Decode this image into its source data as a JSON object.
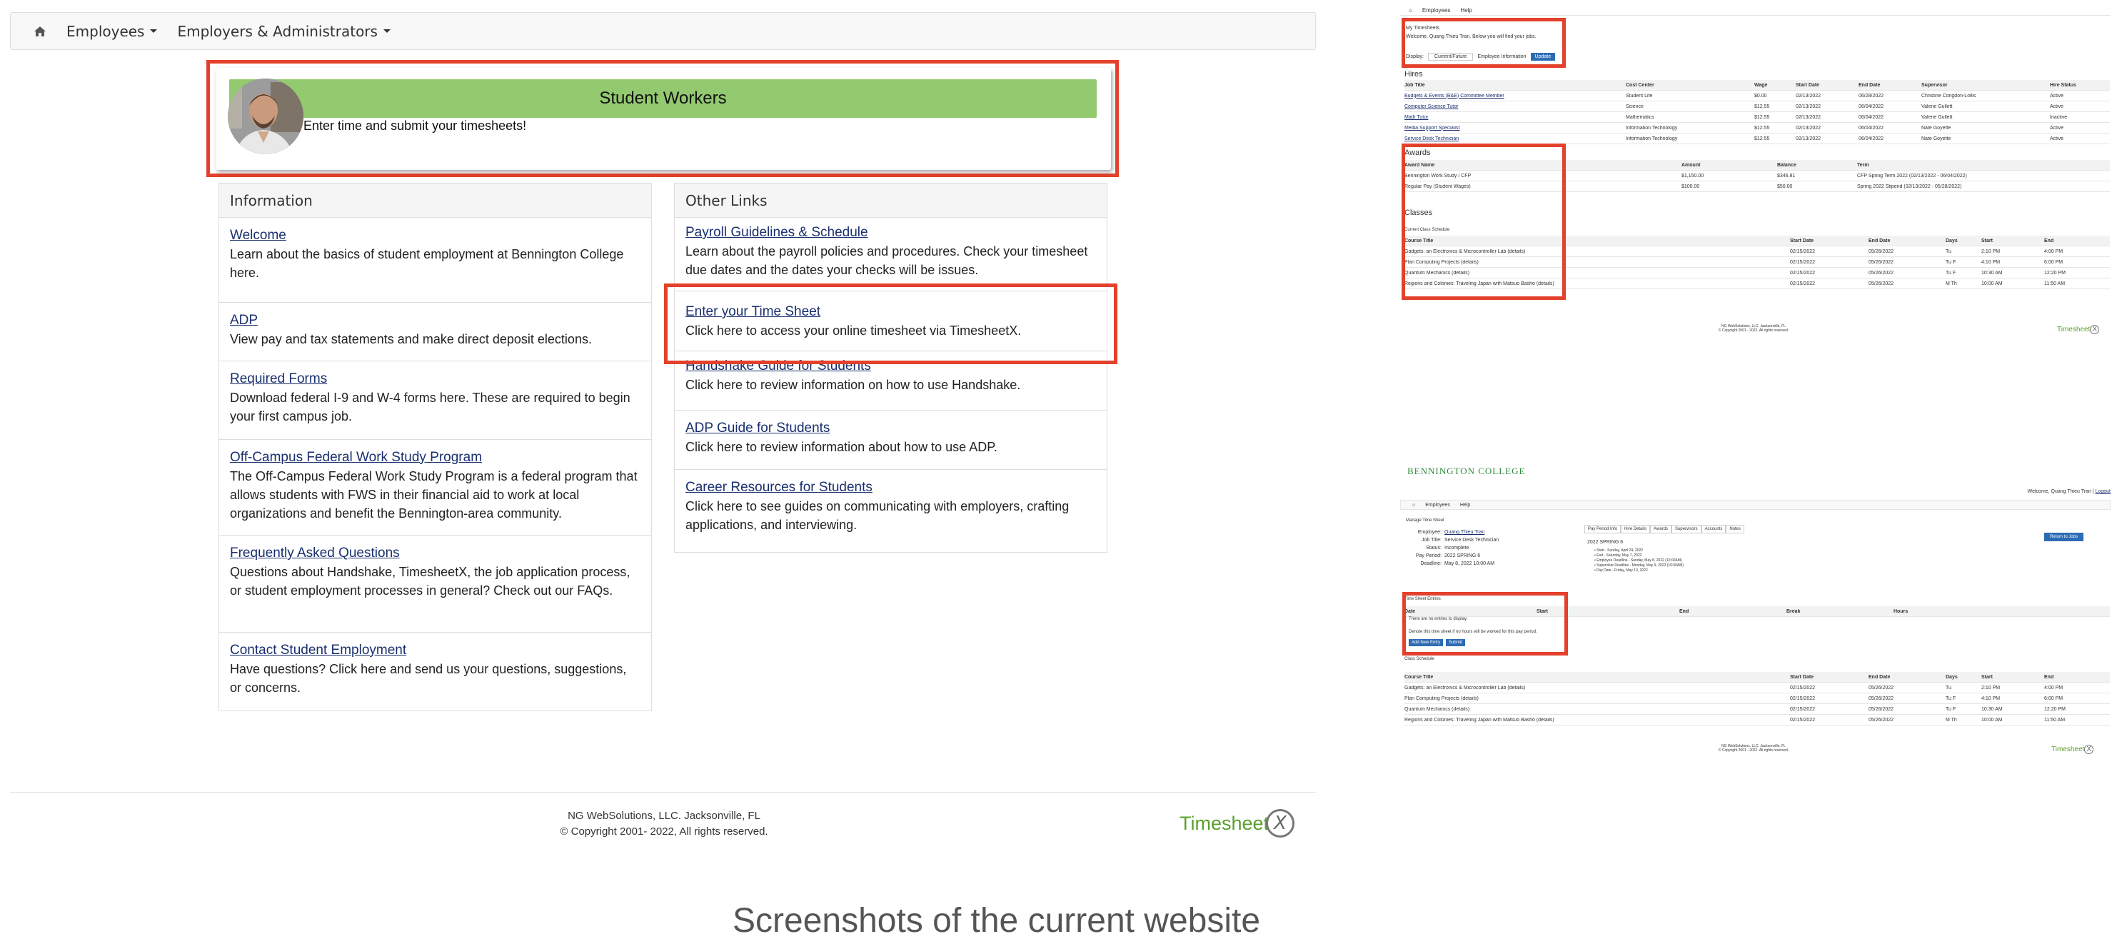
{
  "nav": {
    "employees": "Employees",
    "employers": "Employers & Administrators"
  },
  "banner": {
    "title": "Student Workers",
    "subtitle": "Enter time and submit your timesheets!",
    "color": "#93c96f"
  },
  "information": {
    "heading": "Information",
    "items": [
      {
        "title": "Welcome",
        "desc": "Learn about the basics of student employment at Bennington College here."
      },
      {
        "title": "ADP",
        "desc": "View pay and tax statements and make direct deposit elections."
      },
      {
        "title": "Required Forms",
        "desc": "Download federal I-9 and W-4 forms here. These are required to begin your first campus job."
      },
      {
        "title": "Off-Campus Federal Work Study Program",
        "desc": "The Off-Campus Federal Work Study Program is a federal program that allows students with FWS in their financial aid to work at local organizations and benefit the Bennington-area community."
      },
      {
        "title": "Frequently Asked Questions",
        "desc": "Questions about Handshake, TimesheetX, the job application process, or student employment processes in general? Check out our FAQs."
      },
      {
        "title": "Contact Student Employment",
        "desc": "Have questions? Click here and send us your questions, suggestions, or concerns."
      }
    ]
  },
  "other": {
    "heading": "Other Links",
    "items": [
      {
        "title": "Payroll Guidelines & Schedule",
        "desc": "Learn about the payroll policies and procedures. Check your timesheet due dates and the dates your checks will be issues."
      },
      {
        "title": "Enter your Time Sheet",
        "desc": "Click here to access your online timesheet via TimesheetX."
      },
      {
        "title": "Handshake Guide for Students",
        "desc": "Click here to review information on how to use Handshake."
      },
      {
        "title": "ADP Guide for Students",
        "desc": "Click here to review information about how to use ADP."
      },
      {
        "title": "Career Resources for Students",
        "desc": "Click here to see guides on communicating with employers, crafting applications, and interviewing."
      }
    ]
  },
  "footer": {
    "line1": "NG WebSolutions, LLC. Jacksonville, FL",
    "line2": "© Copyright 2001- 2022,  All rights reserved.",
    "logo": "Timesheet",
    "logo_x": "X"
  },
  "caption": "Screenshots of the current website",
  "right1": {
    "nav_employees": "Employees",
    "nav_help": "Help",
    "my_title": "My Timesheets",
    "welcome": "Welcome, Quang Thieu Tran. Below you will find your jobs.",
    "display_label": "Display:",
    "display_value": "Current/Future",
    "emp_info": "Employee Information",
    "update": "Update",
    "hires_heading": "Hires",
    "hires_cols": [
      "Job Title",
      "Cost Center",
      "Wage",
      "Start Date",
      "End Date",
      "Supervisor",
      "Hire Status"
    ],
    "hires_rows": [
      [
        "Budgets & Events (B&E) Committee Member",
        "Student Life",
        "$0.00",
        "02/13/2022",
        "06/28/2022",
        "Christine Congdon-Lollis",
        "Active"
      ],
      [
        "Computer Science Tutor",
        "Science",
        "$12.55",
        "02/13/2022",
        "06/04/2022",
        "Valerie Gullett",
        "Active"
      ],
      [
        "Math Tutor",
        "Mathematics",
        "$12.55",
        "02/13/2022",
        "06/04/2022",
        "Valerie Gullett",
        "Inactive"
      ],
      [
        "Media Support Specialist",
        "Information Technology",
        "$12.55",
        "02/13/2022",
        "06/04/2022",
        "Nate Goyette",
        "Active"
      ],
      [
        "Service Desk Technician",
        "Information Technology",
        "$12.55",
        "02/13/2022",
        "06/04/2022",
        "Nate Goyette",
        "Active"
      ]
    ],
    "awards_heading": "Awards",
    "awards_cols": [
      "Award Name",
      "Amount",
      "Balance",
      "Term"
    ],
    "awards_rows": [
      [
        "Bennington Work Study / CFP",
        "$1,150.00",
        "$346.81",
        "CFP Spring Term 2022 (02/13/2022 - 06/04/2022)"
      ],
      [
        "Regular Pay (Student Wages)",
        "$100.00",
        "$50.00",
        "Spring 2022 Stipend (02/13/2022 - 05/28/2022)"
      ]
    ],
    "classes_heading": "Classes",
    "classes_sub": "Current Class Schedule",
    "classes_cols": [
      "Course Title",
      "Start Date",
      "End Date",
      "Days",
      "Start",
      "End"
    ],
    "classes_rows": [
      [
        "Gadgets: an Electronics & Microcontroller Lab (details)",
        "02/15/2022",
        "05/26/2022",
        "Tu",
        "2:10 PM",
        "4:00 PM"
      ],
      [
        "Plan Computing Projects (details)",
        "02/15/2022",
        "05/26/2022",
        "Tu F",
        "4:10 PM",
        "6:00 PM"
      ],
      [
        "Quantum Mechanics (details)",
        "02/15/2022",
        "05/26/2022",
        "Tu F",
        "10:30 AM",
        "12:20 PM"
      ],
      [
        "Regions and Colonies: Traveling Japan with Matsuo Basho (details)",
        "02/15/2022",
        "05/26/2022",
        "M Th",
        "10:00 AM",
        "11:50 AM"
      ]
    ],
    "foot1": "NG WebSolutions, LLC. Jacksonville, FL",
    "foot2": "© Copyright 2001 - 2022. All rights reserved.",
    "logo": "Timesheet",
    "logo_x": "X"
  },
  "right2": {
    "college": "BENNINGTON COLLEGE",
    "welcome": "Welcome, Quang Thieu Tran",
    "logout": "Logout",
    "nav_employees": "Employees",
    "nav_help": "Help",
    "manage": "Manage Time Sheet",
    "fields": [
      [
        "Employee:",
        "Quang Thieu Tran"
      ],
      [
        "Job Title:",
        "Service Desk Technician"
      ],
      [
        "Status:",
        "Incomplete"
      ],
      [
        "Pay Period:",
        "2022 SPRING 6"
      ],
      [
        "Deadline:",
        "May 8, 2022 10:00 AM"
      ]
    ],
    "tabs": [
      "Pay Period Info",
      "Hire Details",
      "Awards",
      "Supervisors",
      "Accounts",
      "Notes"
    ],
    "period_title": "2022 SPRING 6",
    "period_lines": [
      "Start - Sunday, April 24, 2022",
      "End - Saturday, May 7, 2022",
      "Employee Deadline - Sunday, May 8, 2022 (10:00AM)",
      "Supervisor Deadline - Monday, May 9, 2022 (10:00AM)",
      "Pay Date - Friday, May 13, 2022"
    ],
    "return_btn": "Return to Jobs",
    "entry_heading": "Time Sheet Entries",
    "entry_cols": [
      "Date",
      "Start",
      "End",
      "Break",
      "Hours"
    ],
    "no_entries": "There are no entries to display.",
    "no_hours": "Denote this time sheet if no hours will be worked for this pay period.",
    "add_btn": "Add New Entry",
    "submit_btn": "Submit",
    "class_heading": "Class Schedule",
    "classes_cols": [
      "Course Title",
      "Start Date",
      "End Date",
      "Days",
      "Start",
      "End"
    ],
    "classes_rows": [
      [
        "Gadgets: an Electronics & Microcontroller Lab (details)",
        "02/15/2022",
        "05/26/2022",
        "Tu",
        "2:10 PM",
        "4:00 PM"
      ],
      [
        "Plan Computing Projects (details)",
        "02/15/2022",
        "05/26/2022",
        "Tu F",
        "4:10 PM",
        "6:00 PM"
      ],
      [
        "Quantum Mechanics (details)",
        "02/15/2022",
        "05/26/2022",
        "Tu F",
        "10:30 AM",
        "12:20 PM"
      ],
      [
        "Regions and Colonies: Traveling Japan with Matsuo Basho (details)",
        "02/15/2022",
        "05/26/2022",
        "M Th",
        "10:00 AM",
        "11:50 AM"
      ]
    ],
    "foot1": "NG WebSolutions, LLC. Jacksonville, FL",
    "foot2": "© Copyright 2001 - 2022. All rights reserved.",
    "logo": "Timesheet",
    "logo_x": "X"
  }
}
